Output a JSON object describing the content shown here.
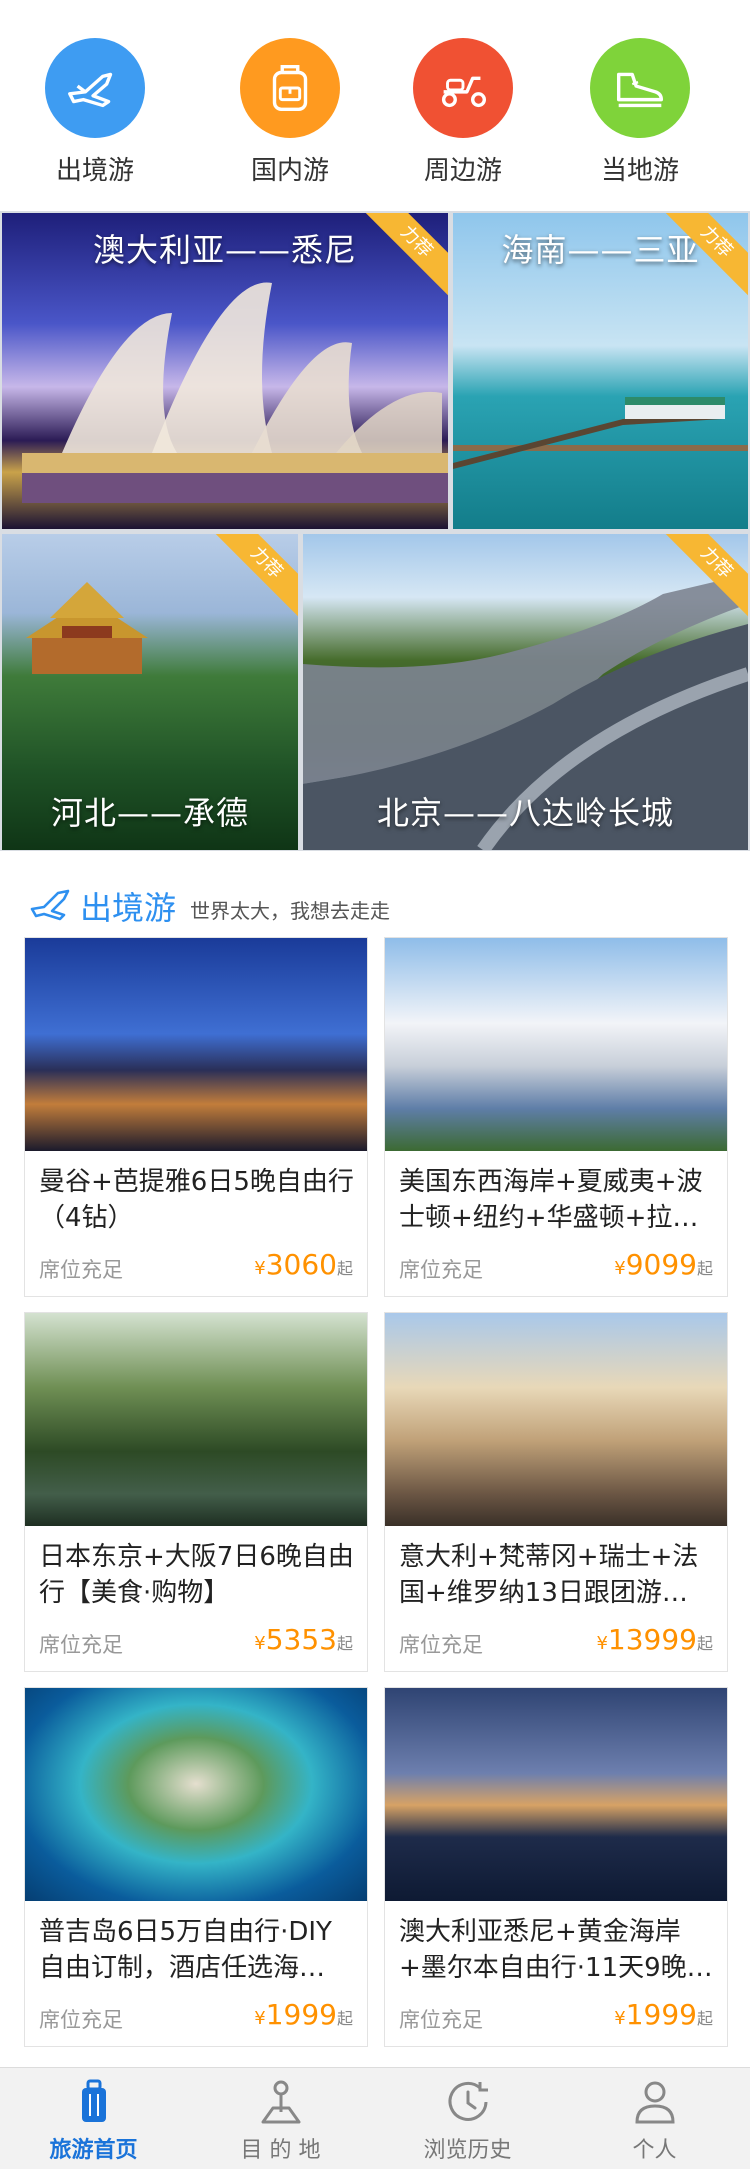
{
  "categories": [
    {
      "label": "出境游",
      "icon": "plane-icon",
      "color": "#3e9cf2"
    },
    {
      "label": "国内游",
      "icon": "backpack-icon",
      "color": "#ff9a1f"
    },
    {
      "label": "周边游",
      "icon": "scooter-icon",
      "color": "#f05133"
    },
    {
      "label": "当地游",
      "icon": "sneaker-icon",
      "color": "#7fd33a"
    }
  ],
  "featured": [
    {
      "title": "澳大利亚——悉尼",
      "badge": "力荐"
    },
    {
      "title": "海南——三亚",
      "badge": "力荐"
    },
    {
      "title": "河北——承德",
      "badge": "力荐"
    },
    {
      "title": "北京——八达岭长城",
      "badge": "力荐"
    }
  ],
  "section": {
    "name": "出境游",
    "slogan": "世界太大，我想去走走",
    "accent": "#2e90f0"
  },
  "products": [
    {
      "title": "曼谷+芭提雅6日5晚自由行（4钻）",
      "availability": "席位充足",
      "currency": "¥",
      "price": "3060",
      "suffix": "起"
    },
    {
      "title": "美国东西海岸+夏威夷+波士顿+纽约+华盛顿+拉…",
      "availability": "席位充足",
      "currency": "¥",
      "price": "9099",
      "suffix": "起"
    },
    {
      "title": "日本东京+大阪7日6晚自由行【美食·购物】",
      "availability": "席位充足",
      "currency": "¥",
      "price": "5353",
      "suffix": "起"
    },
    {
      "title": "意大利+梵蒂冈+瑞士+法国+维罗纳13日跟团游…",
      "availability": "席位充足",
      "currency": "¥",
      "price": "13999",
      "suffix": "起"
    },
    {
      "title": "普吉岛6日5万自由行·DIY自由订制，酒店任选海…",
      "availability": "席位充足",
      "currency": "¥",
      "price": "1999",
      "suffix": "起"
    },
    {
      "title": "澳大利亚悉尼+黄金海岸+墨尔本自由行·11天9晚…",
      "availability": "席位充足",
      "currency": "¥",
      "price": "1999",
      "suffix": "起"
    }
  ],
  "tabs": [
    {
      "label": "旅游首页",
      "icon": "suitcase-icon",
      "active": true
    },
    {
      "label": "目 的 地",
      "icon": "location-pin-icon",
      "active": false
    },
    {
      "label": "浏览历史",
      "icon": "history-clock-icon",
      "active": false
    },
    {
      "label": "个人",
      "icon": "user-icon",
      "active": false
    }
  ],
  "colors": {
    "price": "#ff9100",
    "tab_active": "#1a73d9",
    "badge": "#f7b733"
  }
}
